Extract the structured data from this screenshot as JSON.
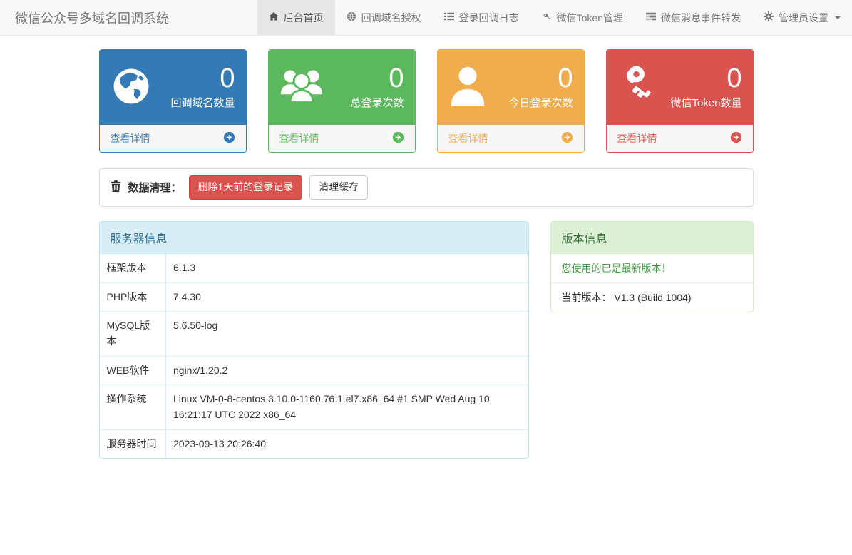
{
  "navbar": {
    "brand": "微信公众号多域名回调系统",
    "items": [
      {
        "label": "后台首页",
        "icon": "home-icon",
        "active": true
      },
      {
        "label": "回调域名授权",
        "icon": "globe-icon",
        "active": false
      },
      {
        "label": "登录回调日志",
        "icon": "list-icon",
        "active": false
      },
      {
        "label": "微信Token管理",
        "icon": "key-icon",
        "active": false
      },
      {
        "label": "微信消息事件转发",
        "icon": "tasks-icon",
        "active": false
      },
      {
        "label": "管理员设置",
        "icon": "gear-icon",
        "active": false,
        "dropdown": true
      }
    ]
  },
  "stats": [
    {
      "value": "0",
      "label": "回调域名数量",
      "detail": "查看详情",
      "color": "#337ab7",
      "icon": "globe-icon"
    },
    {
      "value": "0",
      "label": "总登录次数",
      "detail": "查看详情",
      "color": "#5cb85c",
      "icon": "users-icon"
    },
    {
      "value": "0",
      "label": "今日登录次数",
      "detail": "查看详情",
      "color": "#f0ad4e",
      "icon": "user-icon"
    },
    {
      "value": "0",
      "label": "微信Token数量",
      "detail": "查看详情",
      "color": "#d9534f",
      "icon": "key-icon"
    }
  ],
  "cleanup": {
    "label": "数据清理：",
    "delete_button": "删除1天前的登录记录",
    "cache_button": "清理缓存"
  },
  "server_info": {
    "title": "服务器信息",
    "rows": [
      [
        "框架版本",
        "6.1.3"
      ],
      [
        "PHP版本",
        "7.4.30"
      ],
      [
        "MySQL版本",
        "5.6.50-log"
      ],
      [
        "WEB软件",
        "nginx/1.20.2"
      ],
      [
        "操作系统",
        "Linux VM-0-8-centos 3.10.0-1160.76.1.el7.x86_64 #1 SMP Wed Aug 10 16:21:17 UTC 2022 x86_64"
      ],
      [
        "服务器时间",
        "2023-09-13 20:26:40"
      ]
    ]
  },
  "version_info": {
    "title": "版本信息",
    "latest": "您使用的已是最新版本！",
    "current": "当前版本： V1.3 (Build 1004)"
  },
  "colors": {
    "primary": "#337ab7",
    "success": "#5cb85c",
    "warning": "#f0ad4e",
    "danger": "#d9534f",
    "info_header_bg": "#d9edf7",
    "info_header_text": "#31708f",
    "success_header_bg": "#dff0d8",
    "success_header_text": "#3c763e",
    "navbar_bg": "#f8f8f8",
    "navbar_active_bg": "#e7e7e7"
  }
}
